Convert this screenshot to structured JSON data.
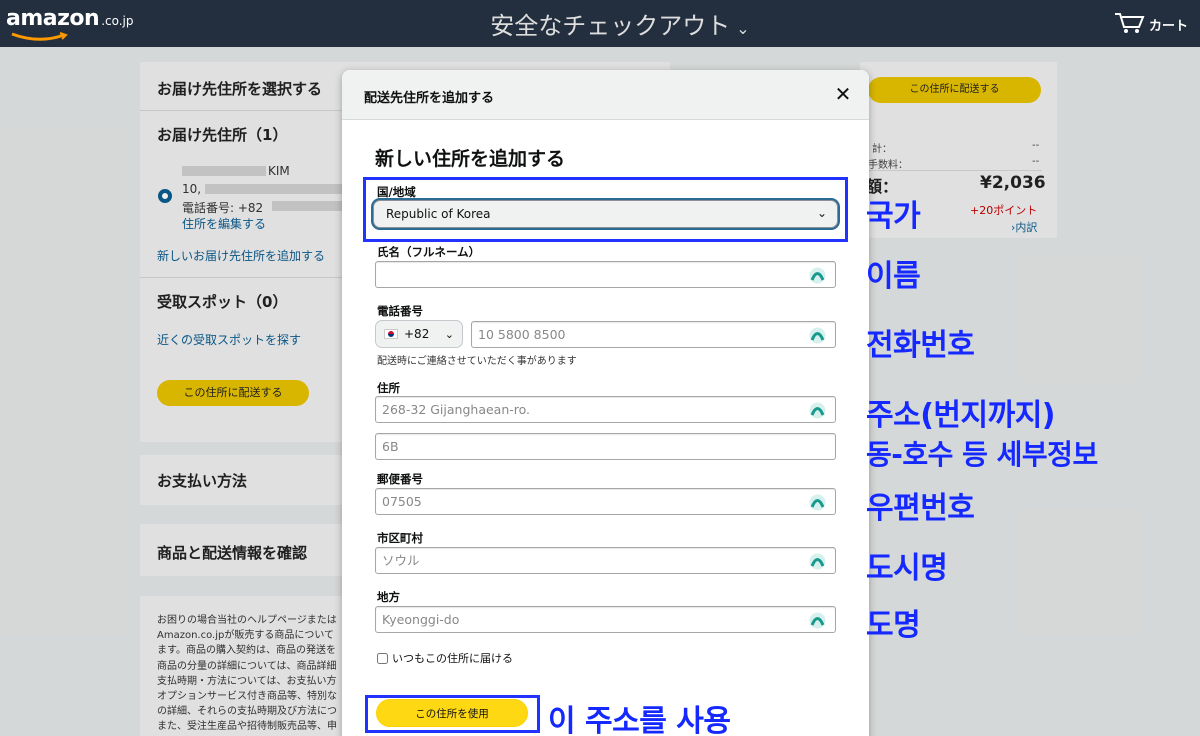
{
  "header": {
    "logo_text": "amazon",
    "logo_tld": ".co.jp",
    "title": "安全なチェックアウト",
    "cart_label": "カート"
  },
  "background": {
    "select_address_heading": "お届け先住所を選択する",
    "addresses_heading": "お届け先住所（1）",
    "address_name": "KIM",
    "address_line": "10,",
    "address_phone": "電話番号: +82",
    "edit_address_link": "住所を編集する",
    "add_new_address_link": "新しいお届け先住所を追加する",
    "pickup_heading": "受取スポット（0）",
    "find_pickup_link": "近くの受取スポットを探す",
    "ship_here_button": "この住所に配送する",
    "payment_heading": "お支払い方法",
    "review_heading": "商品と配送情報を確認",
    "footer_lines": [
      "お困りの場合当社のヘルプページまたは",
      "Amazon.co.jpが販売する商品について",
      "ます。商品の購入契約は、商品の発送を",
      "商品の分量の詳細については、商品詳細",
      "支払時期・方法については、お支払い方",
      "オプションサービス付き商品等、特別な",
      "の詳細、それらの支払時期及び方法につ",
      "また、受注生産品や招待制販売品等、申"
    ],
    "help_link": "ヘルプページ",
    "summary": {
      "ship_here_button": "この住所に配送する",
      "row1_label": "計：",
      "row1_value": "--",
      "row2_label": "手数料：",
      "row2_value": "--",
      "total_label": "額：",
      "total_value": "¥2,036",
      "points": "+20ポイント",
      "breakdown_link": "›内訳"
    }
  },
  "modal": {
    "header_title": "配送先住所を追加する",
    "heading": "新しい住所を追加する",
    "country_label": "国/地域",
    "country_value": "Republic of Korea",
    "name_label": "氏名（フルネーム）",
    "name_value": "",
    "phone_label": "電話番号",
    "phone_country_code": "+82",
    "phone_placeholder": "10 5800 8500",
    "phone_hint": "配送時にご連絡させていただく事があります",
    "address_label": "住所",
    "address1_placeholder": "268-32 Gijanghaean-ro.",
    "address2_placeholder": "6B",
    "postal_label": "郵便番号",
    "postal_placeholder": "07505",
    "city_label": "市区町村",
    "city_placeholder": "ソウル",
    "region_label": "地方",
    "region_placeholder": "Kyeonggi-do",
    "default_checkbox_label": "いつもこの住所に届ける",
    "default_checked": false,
    "use_address_button": "この住所を使用"
  },
  "annotations": {
    "country": "국가",
    "name": "이름",
    "phone": "전화번호",
    "address": "주소(번지까지)",
    "detail": "동-호수 등 세부정보",
    "postal": "우편번호",
    "city": "도시명",
    "province": "도명",
    "use_address": "이 주소를 사용",
    "color": "#1428ff"
  },
  "colors": {
    "header_bg": "#232f3e",
    "button_yellow": "#ffd814",
    "link_blue": "#0b5c8e",
    "points_red": "#c40000"
  }
}
